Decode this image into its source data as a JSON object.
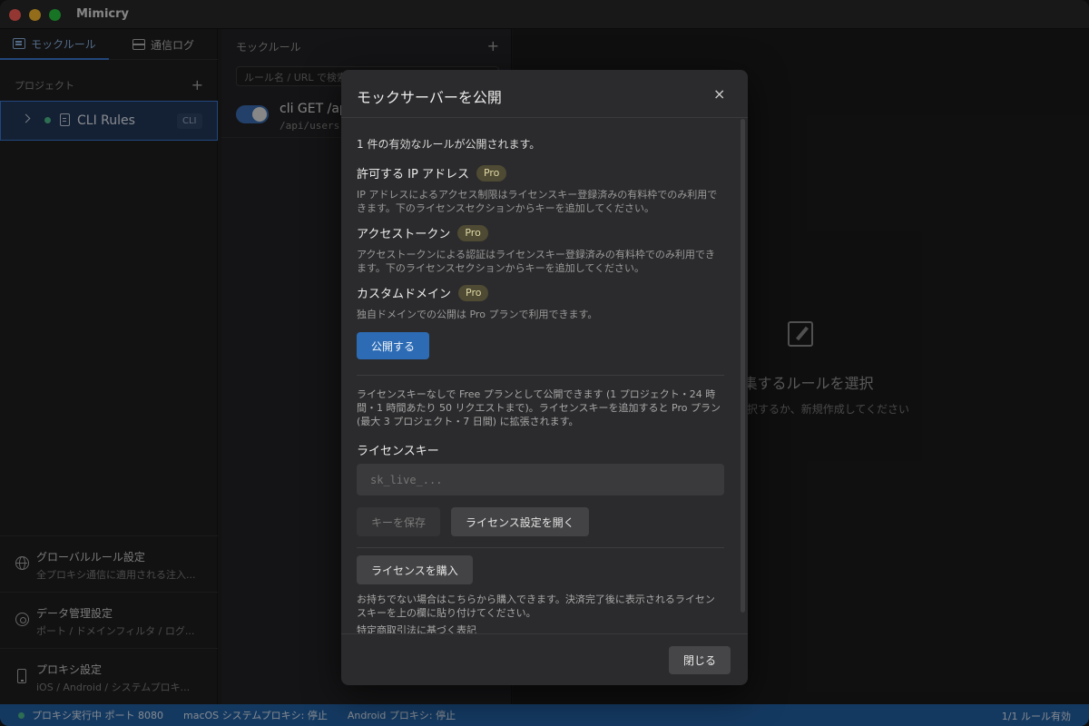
{
  "app": {
    "title": "Mimicry"
  },
  "sidebar": {
    "tabs": [
      {
        "label": "モックルール",
        "icon": "list-icon"
      },
      {
        "label": "通信ログ",
        "icon": "server-icon"
      }
    ],
    "project_header": "プロジェクト",
    "add_symbol": "+",
    "project": {
      "name": "CLI Rules",
      "badge": "CLI"
    },
    "settings": [
      {
        "title": "グローバルルール設定",
        "subtitle": "全プロキシ通信に適用される注入...",
        "icon": "globe-icon"
      },
      {
        "title": "データ管理設定",
        "subtitle": "ポート / ドメインフィルタ / ログ...",
        "icon": "gear-icon"
      },
      {
        "title": "プロキシ設定",
        "subtitle": "iOS / Android / システムプロキ...",
        "icon": "phone-icon"
      }
    ]
  },
  "rules_panel": {
    "header": "モックルール",
    "add_symbol": "+",
    "search_placeholder": "ルール名 / URL で検索",
    "rule": {
      "title": "cli GET /api",
      "path": "/api/users"
    }
  },
  "editor": {
    "empty_title": "編集するルールを選択",
    "empty_subtitle": "ルールを選択するか、新規作成してください"
  },
  "statusbar": {
    "proxy": "プロキシ実行中 ポート 8080",
    "macos": "macOS システムプロキシ: 停止",
    "android": "Android プロキシ: 停止",
    "rules": "1/1 ルール有効"
  },
  "modal": {
    "title": "モックサーバーを公開",
    "close_symbol": "×",
    "summary": "1 件の有効なルールが公開されます。",
    "pro_label": "Pro",
    "ip": {
      "title": "許可する IP アドレス",
      "desc1": "IP アドレスによるアクセス制限はライセンスキー登録済みの有料枠でのみ利用で",
      "desc2": "きます。下のライセンスセクションからキーを追加してください。"
    },
    "token": {
      "title": "アクセストークン",
      "desc1": "アクセストークンによる認証はライセンスキー登録済みの有料枠でのみ利用でき",
      "desc2": "ます。下のライセンスセクションからキーを追加してください。"
    },
    "domain": {
      "title": "カスタムドメイン",
      "desc1": "独自ドメインでの公開は Pro プランで利用できます。"
    },
    "publish_button": "公開する",
    "free_note": {
      "line1": "ライセンスキーなしで Free プランとして公開できます (1 プロジェクト・24 時",
      "line2": "間・1 時間あたり 50 リクエストまで)。ライセンスキーを追加すると Pro プラン",
      "line3": "(最大 3 プロジェクト・7 日間) に拡張されます。"
    },
    "license_label": "ライセンスキー",
    "license_placeholder": "sk_live_...",
    "save_key_button": "キーを保存",
    "open_license_button": "ライセンス設定を開く",
    "buy_license_button": "ライセンスを購入",
    "buy_note": {
      "line1": "お持ちでない場合はこちらから購入できます。決済完了後に表示されるライセン",
      "line2": "スキーを上の欄に貼り付けてください。"
    },
    "legal_link": "特定商取引法に基づく表記",
    "close_button": "閉じる"
  }
}
